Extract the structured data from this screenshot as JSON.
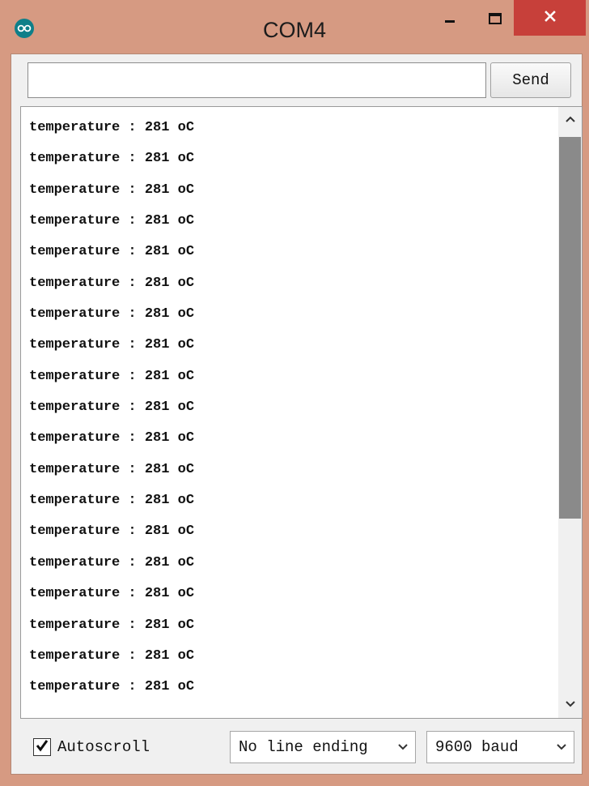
{
  "window": {
    "title": "COM4",
    "icons": {
      "app": "arduino-logo-icon",
      "minimize": "minimize-icon",
      "maximize": "maximize-icon",
      "close": "close-icon"
    }
  },
  "send_bar": {
    "input_value": "",
    "send_label": "Send"
  },
  "output": {
    "lines": [
      "temperature : 281 oC",
      "temperature : 281 oC",
      "temperature : 281 oC",
      "temperature : 281 oC",
      "temperature : 281 oC",
      "temperature : 281 oC",
      "temperature : 281 oC",
      "temperature : 281 oC",
      "temperature : 281 oC",
      "temperature : 281 oC",
      "temperature : 281 oC",
      "temperature : 281 oC",
      "temperature : 281 oC",
      "temperature : 281 oC",
      "temperature : 281 oC",
      "temperature : 281 oC",
      "temperature : 281 oC",
      "temperature : 281 oC",
      "temperature : 281 oC"
    ]
  },
  "footer": {
    "autoscroll_label": "Autoscroll",
    "autoscroll_checked": true,
    "line_ending_selected": "No line ending",
    "baud_selected": "9600 baud"
  },
  "colors": {
    "titlebar": "#d69a82",
    "close_button": "#c7403a",
    "app_icon": "#0f7f89"
  }
}
